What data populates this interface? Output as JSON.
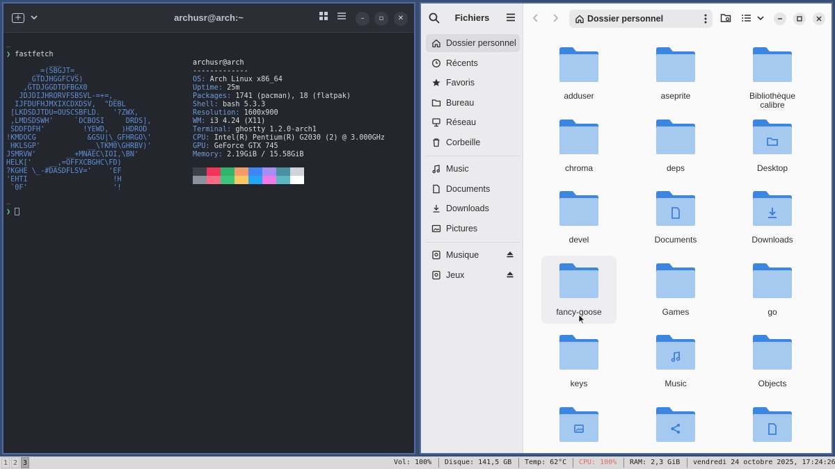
{
  "terminal": {
    "title": "archusr@arch:~",
    "command": "fastfetch",
    "prompt_symbol": "❯",
    "separator": "-------------",
    "user_host": "archusr@arch",
    "art": [
      "          ___",
      "       _=(SBGJT=_",
      "     _GTDJHGGFCVS)",
      "    ,GTDJGGDTDFBGX0",
      "   JDJDIJHRORVFSBSVL-=+=,_",
      "  IJFDUFHJMXIXCDXDSV,  \"DEBL",
      " [LKDSDJTDU=OUSCSBFLD.   '?ZWX,",
      " ,LMDSDSWH'     `DCBOSI     DRDS],",
      " SDDFDFH'         !YEWD,   )HDROD",
      "!KMDOCG            &GSU|\\_GFHRGO\\'",
      " HKLSGP'           __\\TKM0\\GHRBV)'",
      "JSMRVW'       __+MNAEC\\IOI,\\BN'",
      "HELK['    __,=OFFXCBGHC\\FD)",
      "?KGHE \\_-#DASDFLSV='    'EF",
      "'EHTI                    !H",
      " `0F'                    '!"
    ],
    "info": [
      {
        "label": "OS",
        "value": "Arch Linux x86_64"
      },
      {
        "label": "Uptime",
        "value": "25m"
      },
      {
        "label": "Packages",
        "value": "1741 (pacman), 18 (flatpak)"
      },
      {
        "label": "Shell",
        "value": "bash 5.3.3"
      },
      {
        "label": "Resolution",
        "value": "1600x900"
      },
      {
        "label": "WM",
        "value": "i3 4.24 (X11)"
      },
      {
        "label": "Terminal",
        "value": "ghostty 1.2.0-arch1"
      },
      {
        "label": "CPU",
        "value": "Intel(R) Pentium(R) G2030 (2) @ 3.000GHz"
      },
      {
        "label": "GPU",
        "value": "GeForce GTX 745"
      },
      {
        "label": "Memory",
        "value": "2.19GiB / 15.58GiB"
      }
    ],
    "palette_top": [
      "#3b3f47",
      "#f2345b",
      "#2fb66a",
      "#f59b6b",
      "#3d86f5",
      "#a88ef2",
      "#4c8fa3",
      "#cfd4dc"
    ],
    "palette_bottom": [
      "#8b919c",
      "#f86b86",
      "#3cc47a",
      "#f7c963",
      "#22a5f2",
      "#f07be8",
      "#5bb7c4",
      "#ffffff"
    ]
  },
  "files": {
    "app_title": "Fichiers",
    "location": "Dossier personnel",
    "sidebar": {
      "places": [
        {
          "label": "Dossier personnel",
          "icon": "home-icon",
          "active": true
        },
        {
          "label": "Récents",
          "icon": "clock-icon"
        },
        {
          "label": "Favoris",
          "icon": "star-icon"
        },
        {
          "label": "Bureau",
          "icon": "folder-icon"
        },
        {
          "label": "Réseau",
          "icon": "network-icon"
        },
        {
          "label": "Corbeille",
          "icon": "trash-icon"
        }
      ],
      "bookmarks": [
        {
          "label": "Music",
          "icon": "music-icon"
        },
        {
          "label": "Documents",
          "icon": "document-icon"
        },
        {
          "label": "Downloads",
          "icon": "download-icon"
        },
        {
          "label": "Pictures",
          "icon": "picture-icon"
        }
      ],
      "drives": [
        {
          "label": "Musique",
          "icon": "drive-icon"
        },
        {
          "label": "Jeux",
          "icon": "drive-icon"
        }
      ]
    },
    "folders": [
      {
        "name": "adduser",
        "emblem": ""
      },
      {
        "name": "aseprite",
        "emblem": ""
      },
      {
        "name": "Bibliothèque\ncalibre",
        "emblem": ""
      },
      {
        "name": "chroma",
        "emblem": ""
      },
      {
        "name": "deps",
        "emblem": ""
      },
      {
        "name": "Desktop",
        "emblem": "folder"
      },
      {
        "name": "devel",
        "emblem": ""
      },
      {
        "name": "Documents",
        "emblem": "document"
      },
      {
        "name": "Downloads",
        "emblem": "download"
      },
      {
        "name": "fancy-goose",
        "emblem": "",
        "hover": true
      },
      {
        "name": "Games",
        "emblem": ""
      },
      {
        "name": "go",
        "emblem": ""
      },
      {
        "name": "keys",
        "emblem": ""
      },
      {
        "name": "Music",
        "emblem": "music"
      },
      {
        "name": "Objects",
        "emblem": ""
      },
      {
        "name": "",
        "emblem": "picture"
      },
      {
        "name": "",
        "emblem": "share"
      },
      {
        "name": "",
        "emblem": "document"
      }
    ]
  },
  "statusbar": {
    "workspaces": [
      "1",
      "2",
      "3"
    ],
    "active_workspace": "3",
    "volume": "Vol: 100%",
    "disk": "Disque: 141,5 GB",
    "temp": "Temp: 62°C",
    "cpu": "CPU: 100%",
    "ram": "RAM: 2,3 GiB",
    "datetime": "vendredi 24 octobre 2025, 17:24:26"
  }
}
